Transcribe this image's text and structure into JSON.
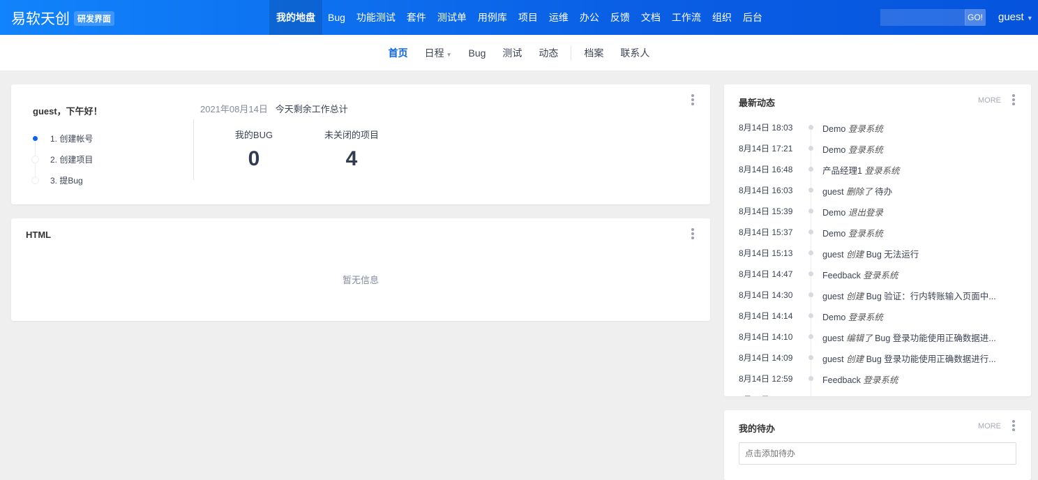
{
  "header": {
    "brand": "易软天创",
    "badge": "研发界面",
    "nav": [
      "我的地盘",
      "Bug",
      "功能测试",
      "套件",
      "测试单",
      "用例库",
      "项目",
      "运维",
      "办公",
      "反馈",
      "文档",
      "工作流",
      "组织",
      "后台"
    ],
    "go": "GO!",
    "user": "guest"
  },
  "subnav": [
    "首页",
    "日程",
    "Bug",
    "测试",
    "动态",
    "档案",
    "联系人"
  ],
  "welcome": {
    "greeting": "guest，下午好！",
    "date": "2021年08月14日",
    "summary": "今天剩余工作总计",
    "steps": [
      "1. 创建帐号",
      "2. 创建项目",
      "3. 提Bug"
    ],
    "stats": [
      {
        "label": "我的BUG",
        "value": "0"
      },
      {
        "label": "未关闭的项目",
        "value": "4"
      }
    ]
  },
  "html_block": {
    "title": "HTML",
    "empty": "暂无信息"
  },
  "activity": {
    "title": "最新动态",
    "more": "MORE",
    "items": [
      {
        "time": "8月14日 18:03",
        "actor": "Demo",
        "action": "登录系统",
        "object": ""
      },
      {
        "time": "8月14日 17:21",
        "actor": "Demo",
        "action": "登录系统",
        "object": ""
      },
      {
        "time": "8月14日 16:48",
        "actor": "产品经理1",
        "action": "登录系统",
        "object": ""
      },
      {
        "time": "8月14日 16:03",
        "actor": "guest",
        "action": "删除了",
        "object": "待办"
      },
      {
        "time": "8月14日 15:39",
        "actor": "Demo",
        "action": "退出登录",
        "object": ""
      },
      {
        "time": "8月14日 15:37",
        "actor": "Demo",
        "action": "登录系统",
        "object": ""
      },
      {
        "time": "8月14日 15:13",
        "actor": "guest",
        "action": "创建",
        "object": "Bug 无法运行"
      },
      {
        "time": "8月14日 14:47",
        "actor": "Feedback",
        "action": "登录系统",
        "object": ""
      },
      {
        "time": "8月14日 14:30",
        "actor": "guest",
        "action": "创建",
        "object": "Bug 验证：行内转账输入页面中..."
      },
      {
        "time": "8月14日 14:14",
        "actor": "Demo",
        "action": "登录系统",
        "object": ""
      },
      {
        "time": "8月14日 14:10",
        "actor": "guest",
        "action": "编辑了",
        "object": "Bug 登录功能使用正确数据进..."
      },
      {
        "time": "8月14日 14:09",
        "actor": "guest",
        "action": "创建",
        "object": "Bug 登录功能使用正确数据进行..."
      },
      {
        "time": "8月14日 12:59",
        "actor": "Feedback",
        "action": "登录系统",
        "object": ""
      }
    ]
  },
  "todo": {
    "title": "我的待办",
    "more": "MORE",
    "placeholder": "点击添加待办"
  }
}
